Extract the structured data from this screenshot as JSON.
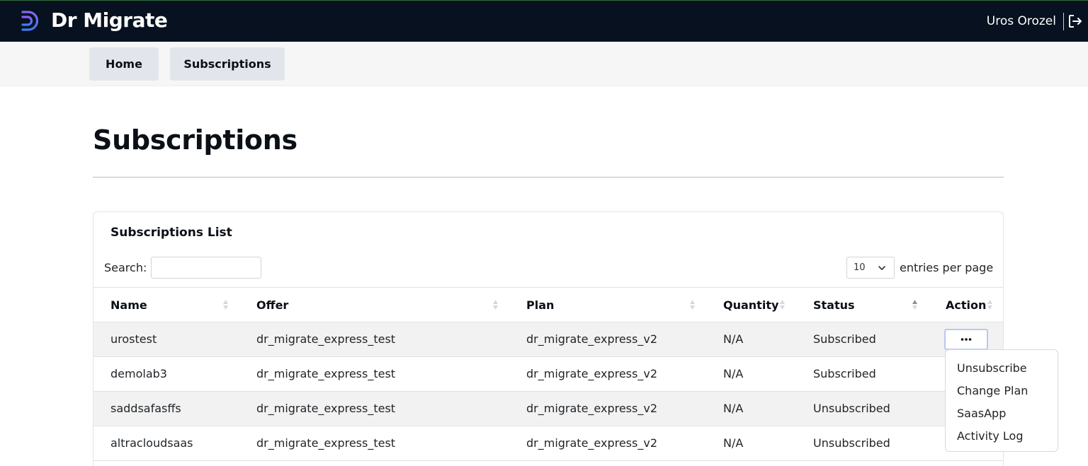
{
  "app": {
    "brand": "Dr Migrate",
    "user_name": "Uros Orozel"
  },
  "nav": {
    "home_label": "Home",
    "subscriptions_label": "Subscriptions"
  },
  "page": {
    "title": "Subscriptions"
  },
  "card": {
    "title": "Subscriptions List",
    "search_label": "Search:",
    "search_value": "",
    "per_page_value": "10",
    "per_page_label": "entries per page"
  },
  "table": {
    "columns": {
      "name": "Name",
      "offer": "Offer",
      "plan": "Plan",
      "quantity": "Quantity",
      "status": "Status",
      "action": "Action"
    },
    "rows": [
      {
        "name": "urostest",
        "offer": "dr_migrate_express_test",
        "plan": "dr_migrate_express_v2",
        "quantity": "N/A",
        "status": "Subscribed"
      },
      {
        "name": "demolab3",
        "offer": "dr_migrate_express_test",
        "plan": "dr_migrate_express_v2",
        "quantity": "N/A",
        "status": "Subscribed"
      },
      {
        "name": "saddsafasffs",
        "offer": "dr_migrate_express_test",
        "plan": "dr_migrate_express_v2",
        "quantity": "N/A",
        "status": "Unsubscribed"
      },
      {
        "name": "altracloudsaas",
        "offer": "dr_migrate_express_test",
        "plan": "dr_migrate_express_v2",
        "quantity": "N/A",
        "status": "Unsubscribed"
      }
    ]
  },
  "action_menu": {
    "items": [
      "Unsubscribe",
      "Change Plan",
      "SaasApp",
      "Activity Log"
    ]
  },
  "colors": {
    "topbar_bg": "#07111f",
    "brand_accent": "#6a5cf0",
    "nav_button_bg": "#e2e6ec"
  },
  "icons": {
    "logo": "dr-migrate-logo-icon",
    "logout": "logout-icon",
    "sort": "sort-arrows-icon",
    "chevron": "chevron-down-icon",
    "ellipsis": "ellipsis-icon"
  }
}
